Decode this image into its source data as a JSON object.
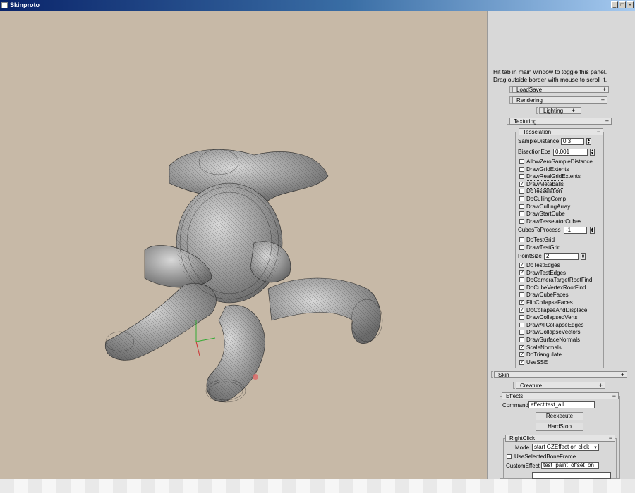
{
  "window": {
    "title": "Skinproto",
    "min_icon": "minimize-icon",
    "max_icon": "maximize-icon",
    "close_icon": "close-icon",
    "min_glyph": "_",
    "max_glyph": "□",
    "close_glyph": "×"
  },
  "panel": {
    "hint_line1": "Hit tab in main window to toggle this panel.",
    "hint_line2": "Drag outside border with mouse to scroll it.",
    "rollouts": {
      "loadsave": {
        "label": "LoadSave",
        "toggle": "+"
      },
      "rendering": {
        "label": "Rendering",
        "toggle": "+"
      },
      "lighting": {
        "label": "Lighting",
        "toggle": "+"
      },
      "texturing": {
        "label": "Texturing",
        "toggle": "+"
      },
      "tesselation": {
        "label": "Tesselation",
        "toggle": "−"
      },
      "skin": {
        "label": "Skin",
        "toggle": "+"
      },
      "creature": {
        "label": "Creature",
        "toggle": "+"
      },
      "effects": {
        "label": "Effects",
        "toggle": "−"
      },
      "rightclick": {
        "label": "RightClick",
        "toggle": "−"
      }
    },
    "tesselation": {
      "sample_distance_label": "SampleDistance",
      "sample_distance_value": "0.3",
      "bisection_eps_label": "BisectionEps",
      "bisection_eps_value": "0.001",
      "checks_a": [
        {
          "label": "AllowZeroSampleDistance",
          "checked": false
        },
        {
          "label": "DrawGridExtents",
          "checked": false
        },
        {
          "label": "DrawRealGridExtents",
          "checked": false
        },
        {
          "label": "DrawMetaballs",
          "checked": true
        },
        {
          "label": "DoTesselation",
          "checked": false
        },
        {
          "label": "DoCullingComp",
          "checked": false
        },
        {
          "label": "DrawCullingArray",
          "checked": false
        },
        {
          "label": "DrawStartCube",
          "checked": false
        },
        {
          "label": "DrawTesselatorCubes",
          "checked": false
        }
      ],
      "cubes_to_process_label": "CubesToProcess",
      "cubes_to_process_value": "-1",
      "checks_b": [
        {
          "label": "DoTestGrid",
          "checked": false
        },
        {
          "label": "DrawTestGrid",
          "checked": false
        }
      ],
      "point_size_label": "PointSize",
      "point_size_value": "2",
      "checks_c": [
        {
          "label": "DoTestEdges",
          "checked": true
        },
        {
          "label": "DrawTestEdges",
          "checked": true
        },
        {
          "label": "DoCameraTargetRootFind",
          "checked": false
        },
        {
          "label": "DoCubeVertexRootFind",
          "checked": false
        },
        {
          "label": "DrawCubeFaces",
          "checked": false
        },
        {
          "label": "FlipCollapseFaces",
          "checked": true
        },
        {
          "label": "DoCollapseAndDisplace",
          "checked": true
        },
        {
          "label": "DrawCollapsedVerts",
          "checked": false
        },
        {
          "label": "DrawAllCollapseEdges",
          "checked": false
        },
        {
          "label": "DrawCollapseVectors",
          "checked": false
        },
        {
          "label": "DrawSurfaceNormals",
          "checked": false
        },
        {
          "label": "ScaleNormals",
          "checked": true
        },
        {
          "label": "DoTriangulate",
          "checked": true
        },
        {
          "label": "UseSSE",
          "checked": true
        }
      ]
    },
    "effects": {
      "command_label": "Command",
      "command_value": "effect test_all",
      "reexecute_label": "Reexecute",
      "hardstop_label": "HardStop"
    },
    "rightclick": {
      "mode_label": "Mode",
      "mode_value": "start GZEffect on click",
      "use_selected_label": "UseSelectedBoneFrame",
      "use_selected_checked": false,
      "custom_effect_label": "CustomEffect",
      "custom_effect_value": "test_paint_offset_on"
    }
  },
  "viewport": {
    "background": "#c7b9a7"
  }
}
